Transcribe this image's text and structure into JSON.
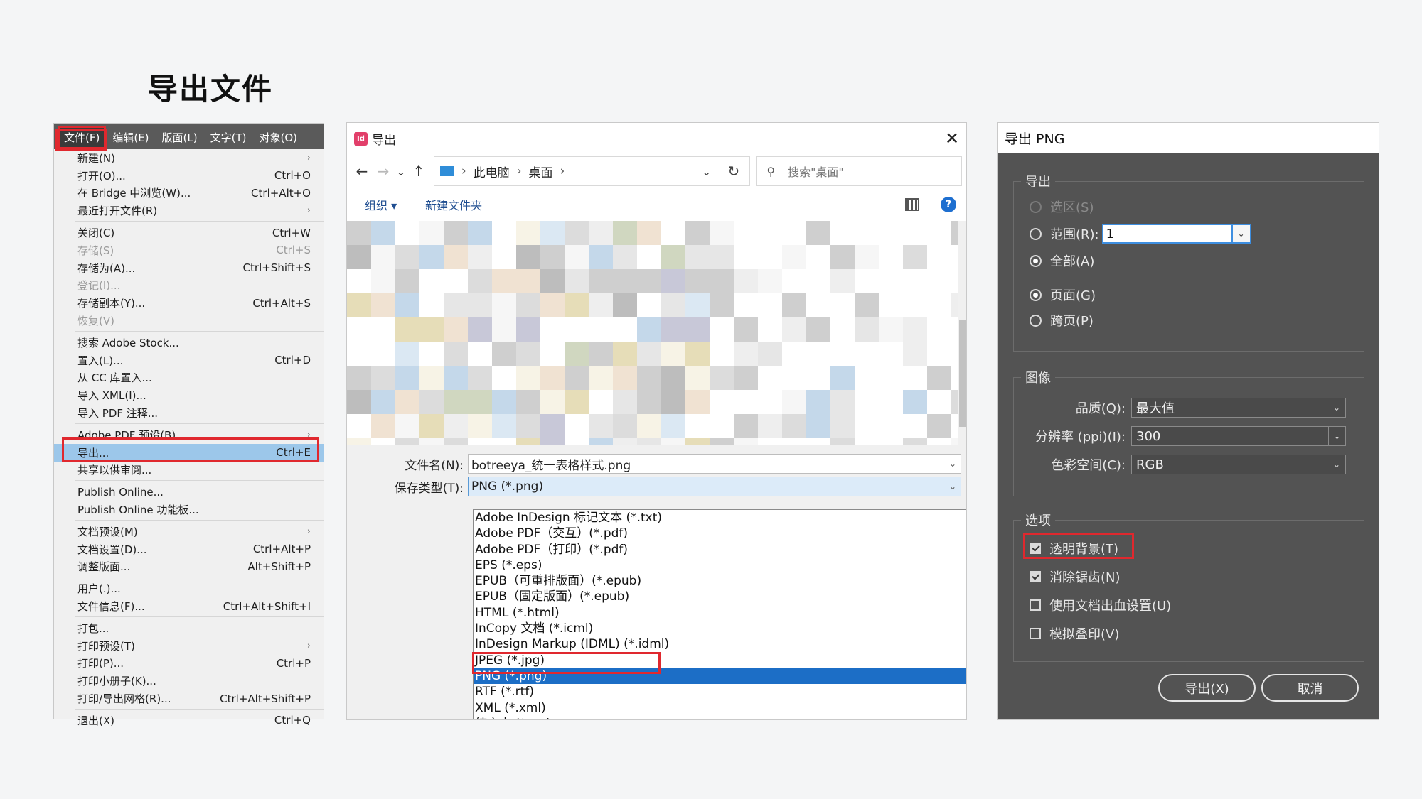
{
  "page": {
    "title": "导出文件"
  },
  "file_menu": {
    "menubar": [
      "文件(F)",
      "编辑(E)",
      "版面(L)",
      "文字(T)",
      "对象(O)"
    ],
    "items": [
      {
        "label": "新建(N)",
        "shortcut": "",
        "submenu": true
      },
      {
        "label": "打开(O)...",
        "shortcut": "Ctrl+O"
      },
      {
        "label": "在 Bridge 中浏览(W)...",
        "shortcut": "Ctrl+Alt+O"
      },
      {
        "label": "最近打开文件(R)",
        "shortcut": "",
        "submenu": true
      },
      {
        "sep": true
      },
      {
        "label": "关闭(C)",
        "shortcut": "Ctrl+W"
      },
      {
        "label": "存储(S)",
        "shortcut": "Ctrl+S",
        "disabled": true
      },
      {
        "label": "存储为(A)...",
        "shortcut": "Ctrl+Shift+S"
      },
      {
        "label": "登记(I)...",
        "shortcut": "",
        "disabled": true
      },
      {
        "label": "存储副本(Y)...",
        "shortcut": "Ctrl+Alt+S"
      },
      {
        "label": "恢复(V)",
        "shortcut": "",
        "disabled": true
      },
      {
        "sep": true
      },
      {
        "label": "搜索 Adobe Stock...",
        "shortcut": ""
      },
      {
        "label": "置入(L)...",
        "shortcut": "Ctrl+D"
      },
      {
        "label": "从 CC 库置入...",
        "shortcut": ""
      },
      {
        "label": "导入 XML(I)...",
        "shortcut": ""
      },
      {
        "label": "导入 PDF 注释...",
        "shortcut": ""
      },
      {
        "sep": true
      },
      {
        "label": "Adobe PDF 预设(B)",
        "shortcut": "",
        "submenu": true
      },
      {
        "label": "导出...",
        "shortcut": "Ctrl+E",
        "selected": true
      },
      {
        "label": "共享以供审阅...",
        "shortcut": ""
      },
      {
        "sep": true
      },
      {
        "label": "Publish Online...",
        "shortcut": ""
      },
      {
        "label": "Publish Online 功能板...",
        "shortcut": ""
      },
      {
        "sep": true
      },
      {
        "label": "文档预设(M)",
        "shortcut": "",
        "submenu": true
      },
      {
        "label": "文档设置(D)...",
        "shortcut": "Ctrl+Alt+P"
      },
      {
        "label": "调整版面...",
        "shortcut": "Alt+Shift+P"
      },
      {
        "sep": true
      },
      {
        "label": "用户(.)...",
        "shortcut": ""
      },
      {
        "label": "文件信息(F)...",
        "shortcut": "Ctrl+Alt+Shift+I"
      },
      {
        "sep": true
      },
      {
        "label": "打包...",
        "shortcut": ""
      },
      {
        "label": "打印预设(T)",
        "shortcut": "",
        "submenu": true
      },
      {
        "label": "打印(P)...",
        "shortcut": "Ctrl+P"
      },
      {
        "label": "打印小册子(K)...",
        "shortcut": ""
      },
      {
        "label": "打印/导出网格(R)...",
        "shortcut": "Ctrl+Alt+Shift+P"
      },
      {
        "sep": true
      },
      {
        "label": "退出(X)",
        "shortcut": "Ctrl+Q"
      }
    ]
  },
  "export_dialog": {
    "app_badge": "Id",
    "title": "导出",
    "close": "✕",
    "nav": {
      "back": "←",
      "forward": "→",
      "recent": "⌄",
      "up": "↑",
      "refresh": "↻"
    },
    "breadcrumb": [
      "此电脑",
      "桌面"
    ],
    "search_placeholder": "搜索\"桌面\"",
    "commands": {
      "organize": "组织 ▾",
      "new_folder": "新建文件夹",
      "view": "▾",
      "help": "?"
    },
    "filename_label": "文件名(N):",
    "filename_value": "botreeya_统一表格样式.png",
    "type_label": "保存类型(T):",
    "type_value": "PNG (*.png)",
    "type_options": [
      {
        "label": "Adobe InDesign 标记文本 (*.txt)"
      },
      {
        "label": "Adobe PDF（交互）(*.pdf)"
      },
      {
        "label": "Adobe PDF（打印）(*.pdf)"
      },
      {
        "label": "EPS (*.eps)"
      },
      {
        "label": "EPUB（可重排版面）(*.epub)"
      },
      {
        "label": "EPUB（固定版面）(*.epub)"
      },
      {
        "label": "HTML (*.html)"
      },
      {
        "label": "InCopy 文档 (*.icml)"
      },
      {
        "label": "InDesign Markup (IDML) (*.idml)"
      },
      {
        "label": "JPEG (*.jpg)"
      },
      {
        "label": "PNG (*.png)",
        "selected": true
      },
      {
        "label": "RTF (*.rtf)"
      },
      {
        "label": "XML (*.xml)"
      },
      {
        "label": "纯文本 (*.txt)"
      }
    ],
    "dd_glyph": "⌄"
  },
  "png_export": {
    "title": "导出 PNG",
    "export_group": {
      "title": "导出",
      "selection": "选区(S)",
      "range": "范围(R):",
      "range_value": "1",
      "all": "全部(A)",
      "pages": "页面(G)",
      "spreads": "跨页(P)"
    },
    "image_group": {
      "title": "图像",
      "quality_label": "品质(Q):",
      "quality_value": "最大值",
      "resolution_label": "分辨率 (ppi)(I):",
      "resolution_value": "300",
      "colorspace_label": "色彩空间(C):",
      "colorspace_value": "RGB"
    },
    "options_group": {
      "title": "选项",
      "transparent_bg": "透明背景(T)",
      "antialias": "消除锯齿(N)",
      "use_bleed": "使用文档出血设置(U)",
      "simulate_overprint": "模拟叠印(V)"
    },
    "export_btn": "导出(X)",
    "cancel_btn": "取消",
    "dd_glyph": "⌄"
  },
  "colors": {
    "highlight_red": "#e0282e",
    "menu_selected": "#9cc7ea",
    "list_selected": "#1c6ec6",
    "panel_dark": "#535353"
  }
}
